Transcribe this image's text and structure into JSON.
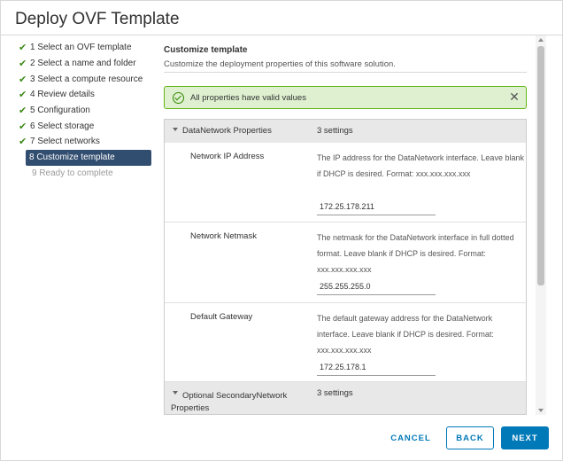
{
  "dialog": {
    "title": "Deploy OVF Template"
  },
  "steps": [
    {
      "label": "1 Select an OVF template",
      "state": "done"
    },
    {
      "label": "2 Select a name and folder",
      "state": "done"
    },
    {
      "label": "3 Select a compute resource",
      "state": "done"
    },
    {
      "label": "4 Review details",
      "state": "done"
    },
    {
      "label": "5 Configuration",
      "state": "done"
    },
    {
      "label": "6 Select storage",
      "state": "done"
    },
    {
      "label": "7 Select networks",
      "state": "done"
    },
    {
      "label": "8 Customize template",
      "state": "active"
    },
    {
      "label": "9 Ready to complete",
      "state": "disabled"
    }
  ],
  "check_glyph": "✔",
  "main": {
    "title": "Customize template",
    "subtitle": "Customize the deployment properties of this software solution."
  },
  "alert": {
    "text": "All properties have valid values",
    "close_glyph": "✕"
  },
  "groups": [
    {
      "name": "DataNetwork Properties",
      "count": "3 settings",
      "rows": [
        {
          "label": "Network IP Address",
          "description": "The IP address for the DataNetwork interface. Leave blank if DHCP is desired. Format: xxx.xxx.xxx.xxx",
          "value": "172.25.178.211"
        },
        {
          "label": "Network Netmask",
          "description": "The netmask for the DataNetwork interface in full dotted format. Leave blank if DHCP is desired. Format: xxx.xxx.xxx.xxx",
          "value": "255.255.255.0"
        },
        {
          "label": "Default Gateway",
          "description": "The default gateway address for the DataNetwork interface. Leave blank if DHCP is desired. Format: xxx.xxx.xxx.xxx",
          "value": "172.25.178.1"
        }
      ]
    },
    {
      "name_line1": "Optional SecondaryNetwork",
      "name_line2": "Properties",
      "count": "3 settings"
    }
  ],
  "footer": {
    "cancel": "CANCEL",
    "back": "BACK",
    "next": "NEXT"
  },
  "colors": {
    "accent": "#0079b8",
    "success": "#60b515",
    "active_step": "#314d6f"
  }
}
